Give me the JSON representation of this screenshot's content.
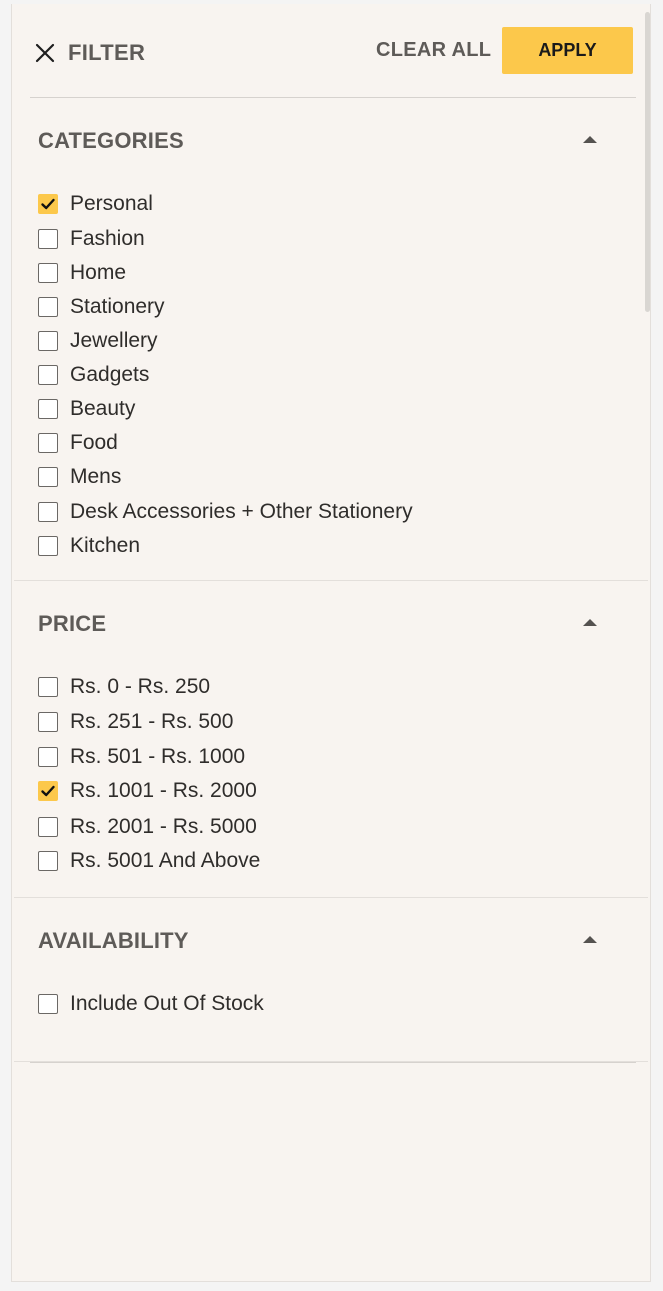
{
  "header": {
    "title": "FILTER",
    "clear_all": "CLEAR ALL",
    "apply": "APPLY",
    "close_icon": "close-icon"
  },
  "colors": {
    "accent": "#fcc84b",
    "panel_bg": "#f8f4f0",
    "heading": "#5e5b58"
  },
  "sections": [
    {
      "title": "CATEGORIES",
      "expanded": true,
      "options": [
        {
          "label": "Personal",
          "checked": true
        },
        {
          "label": "Fashion",
          "checked": false
        },
        {
          "label": "Home",
          "checked": false
        },
        {
          "label": "Stationery",
          "checked": false
        },
        {
          "label": "Jewellery",
          "checked": false
        },
        {
          "label": "Gadgets",
          "checked": false
        },
        {
          "label": "Beauty",
          "checked": false
        },
        {
          "label": "Food",
          "checked": false
        },
        {
          "label": "Mens",
          "checked": false
        },
        {
          "label": "Desk Accessories + Other Stationery",
          "checked": false
        },
        {
          "label": "Kitchen",
          "checked": false
        }
      ]
    },
    {
      "title": "PRICE",
      "expanded": true,
      "options": [
        {
          "label": "Rs. 0 - Rs. 250",
          "checked": false
        },
        {
          "label": "Rs. 251 - Rs. 500",
          "checked": false
        },
        {
          "label": "Rs. 501 - Rs. 1000",
          "checked": false
        },
        {
          "label": "Rs. 1001 - Rs. 2000",
          "checked": true
        },
        {
          "label": "Rs. 2001 - Rs. 5000",
          "checked": false
        },
        {
          "label": "Rs. 5001 And Above",
          "checked": false
        }
      ]
    },
    {
      "title": "AVAILABILITY",
      "expanded": true,
      "options": [
        {
          "label": "Include Out Of Stock",
          "checked": false
        }
      ]
    }
  ]
}
